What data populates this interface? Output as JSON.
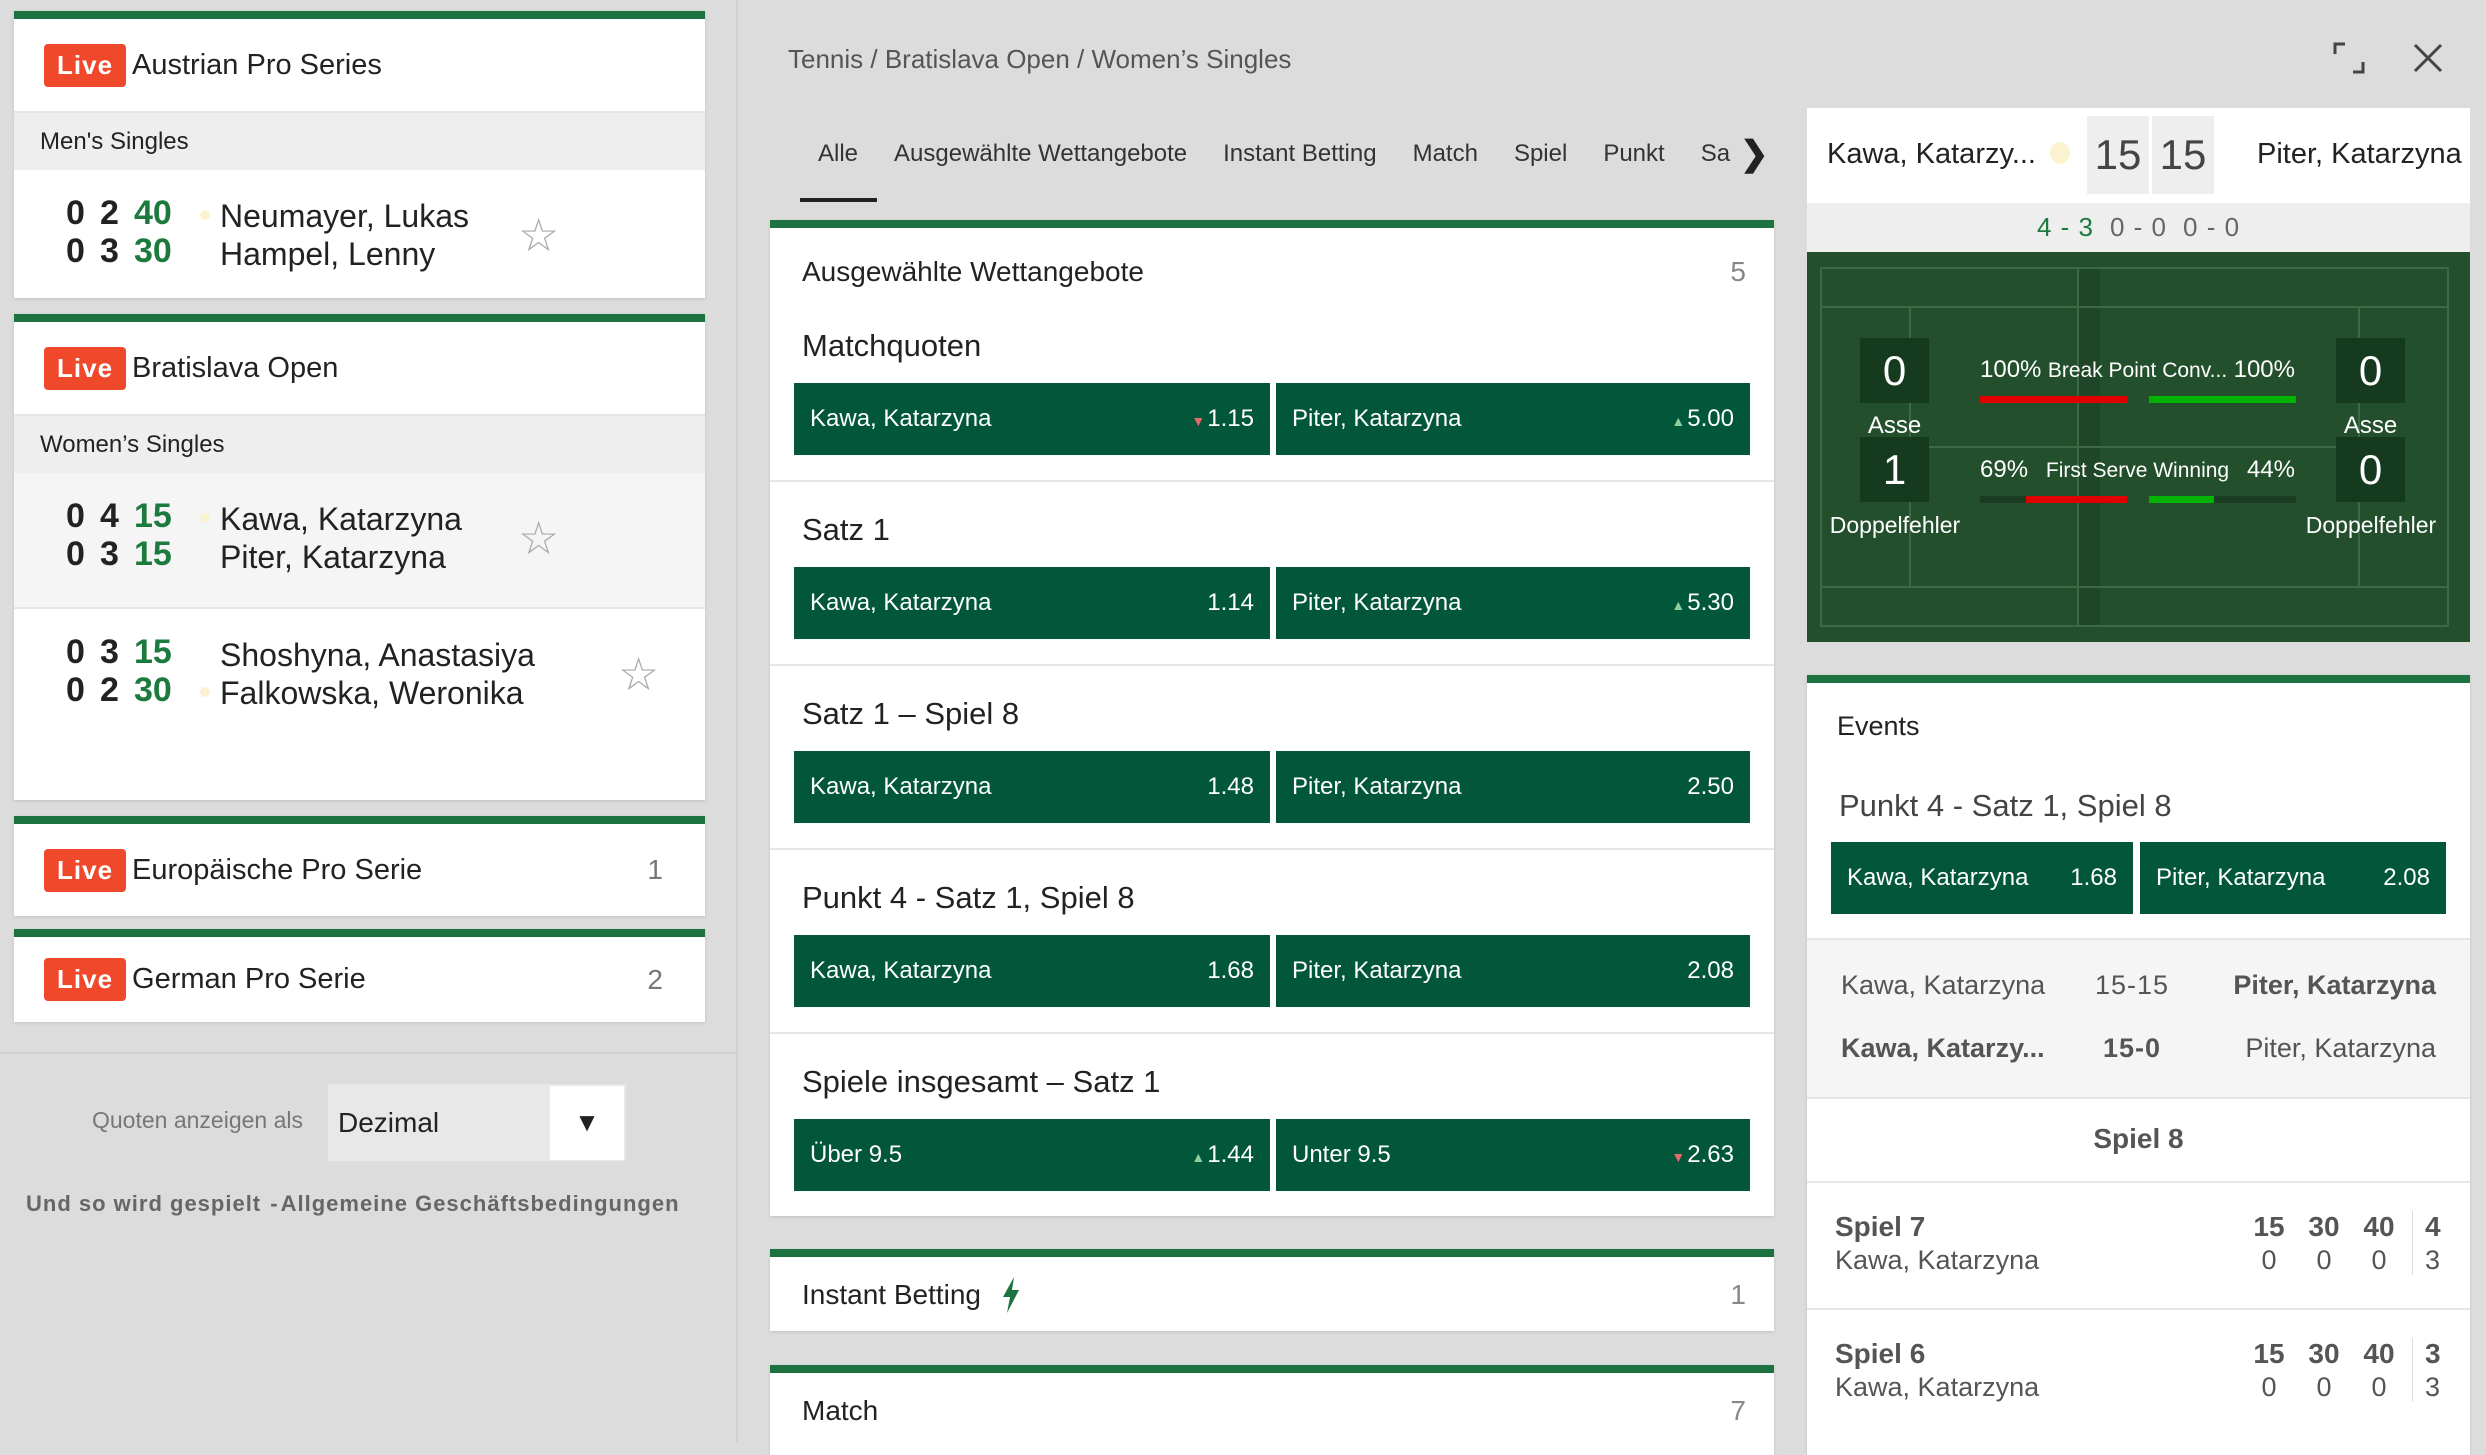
{
  "left": {
    "live_label": "Live",
    "competitions": [
      {
        "name": "Austrian Pro Series",
        "category": "Men's Singles",
        "matches": [
          {
            "p1": "Neumayer, Lukas",
            "p2": "Hampel, Lenny",
            "s1": [
              "0",
              "2",
              "40"
            ],
            "s2": [
              "0",
              "3",
              "30"
            ],
            "server": 1
          }
        ]
      },
      {
        "name": "Bratislava Open",
        "category": "Women’s Singles",
        "matches": [
          {
            "p1": "Kawa, Katarzyna",
            "p2": "Piter, Katarzyna",
            "s1": [
              "0",
              "4",
              "15"
            ],
            "s2": [
              "0",
              "3",
              "15"
            ],
            "server": 1,
            "selected": true
          },
          {
            "p1": "Shoshyna, Anastasiya",
            "p2": "Falkowska, Weronika",
            "s1": [
              "0",
              "3",
              "15"
            ],
            "s2": [
              "0",
              "2",
              "30"
            ],
            "server": 2
          }
        ]
      },
      {
        "name": "Europäische Pro Serie",
        "count": "1"
      },
      {
        "name": "German Pro Serie",
        "count": "2"
      }
    ],
    "odds_label": "Quoten anzeigen als",
    "odds_value": "Dezimal",
    "footer_links": [
      "Und so wird gespielt",
      "Allgemeine Geschäftsbedingungen"
    ]
  },
  "center": {
    "breadcrumb": [
      "Tennis",
      "Bratislava Open",
      "Women’s Singles"
    ],
    "tabs": [
      "Alle",
      "Ausgewählte Wettangebote",
      "Instant Betting",
      "Match",
      "Spiel",
      "Punkt",
      "Sa"
    ],
    "active_tab": "Alle",
    "featured": {
      "title": "Ausgewählte Wettangebote",
      "count": "5",
      "markets": [
        {
          "title": "Matchquoten",
          "options": [
            {
              "label": "Kawa, Katarzyna",
              "odds": "1.15",
              "trend": "down"
            },
            {
              "label": "Piter, Katarzyna",
              "odds": "5.00",
              "trend": "up"
            }
          ]
        },
        {
          "title": "Satz 1",
          "options": [
            {
              "label": "Kawa, Katarzyna",
              "odds": "1.14",
              "trend": ""
            },
            {
              "label": "Piter, Katarzyna",
              "odds": "5.30",
              "trend": "up"
            }
          ]
        },
        {
          "title": "Satz 1 – Spiel 8",
          "options": [
            {
              "label": "Kawa, Katarzyna",
              "odds": "1.48",
              "trend": ""
            },
            {
              "label": "Piter, Katarzyna",
              "odds": "2.50",
              "trend": ""
            }
          ]
        },
        {
          "title": "Punkt 4 - Satz 1, Spiel 8",
          "options": [
            {
              "label": "Kawa, Katarzyna",
              "odds": "1.68",
              "trend": ""
            },
            {
              "label": "Piter, Katarzyna",
              "odds": "2.08",
              "trend": ""
            }
          ]
        },
        {
          "title": "Spiele insgesamt – Satz 1",
          "options": [
            {
              "label": "Über 9.5",
              "odds": "1.44",
              "trend": "up"
            },
            {
              "label": "Unter 9.5",
              "odds": "2.63",
              "trend": "down"
            }
          ]
        }
      ]
    },
    "instant": {
      "title": "Instant Betting",
      "count": "1"
    },
    "match": {
      "title": "Match",
      "count": "7"
    }
  },
  "scoreboard": {
    "p1": "Kawa, Katarzy...",
    "p2": "Piter, Katarzyna",
    "points1": "15",
    "points2": "15",
    "sets": [
      "4 - 3",
      "0 - 0",
      "0 - 0"
    ],
    "stats": {
      "aces": [
        "0",
        "0"
      ],
      "aces_label": "Asse",
      "double_faults": [
        "1",
        "0"
      ],
      "df_label": "Doppelfehler",
      "bp": {
        "label": "Break Point Conv...",
        "v1": "100%",
        "v2": "100%",
        "f1": 1.0,
        "f2": 1.0
      },
      "fs": {
        "label": "First Serve Winning",
        "v1": "69%",
        "v2": "44%",
        "f1": 0.69,
        "f2": 0.44
      }
    },
    "colors": {
      "court": "#234f2d",
      "p1_bar": "#e00000",
      "p2_bar": "#00b300"
    }
  },
  "events": {
    "title": "Events",
    "market": {
      "title": "Punkt 4 - Satz 1, Spiel 8",
      "options": [
        {
          "label": "Kawa, Katarzyna",
          "odds": "1.68"
        },
        {
          "label": "Piter, Katarzyna",
          "odds": "2.08"
        }
      ]
    },
    "points": [
      {
        "p1": "Kawa, Katarzyna",
        "score": "15-15",
        "p2": "Piter, Katarzyna"
      },
      {
        "p1": "Kawa, Katarzy...",
        "score": "15-0",
        "p2": "Piter, Katarzyna"
      }
    ],
    "current_game": "Spiel 8",
    "games": [
      {
        "title": "Spiel 7",
        "server": "Kawa, Katarzyna",
        "top": [
          "15",
          "30",
          "40"
        ],
        "bottom": [
          "0",
          "0",
          "0"
        ],
        "g1": "4",
        "g2": "3"
      },
      {
        "title": "Spiel 6",
        "server": "Kawa, Katarzyna",
        "top": [
          "15",
          "30",
          "40"
        ],
        "bottom": [
          "0",
          "0",
          "0"
        ],
        "g1": "3",
        "g2": "3"
      }
    ]
  }
}
